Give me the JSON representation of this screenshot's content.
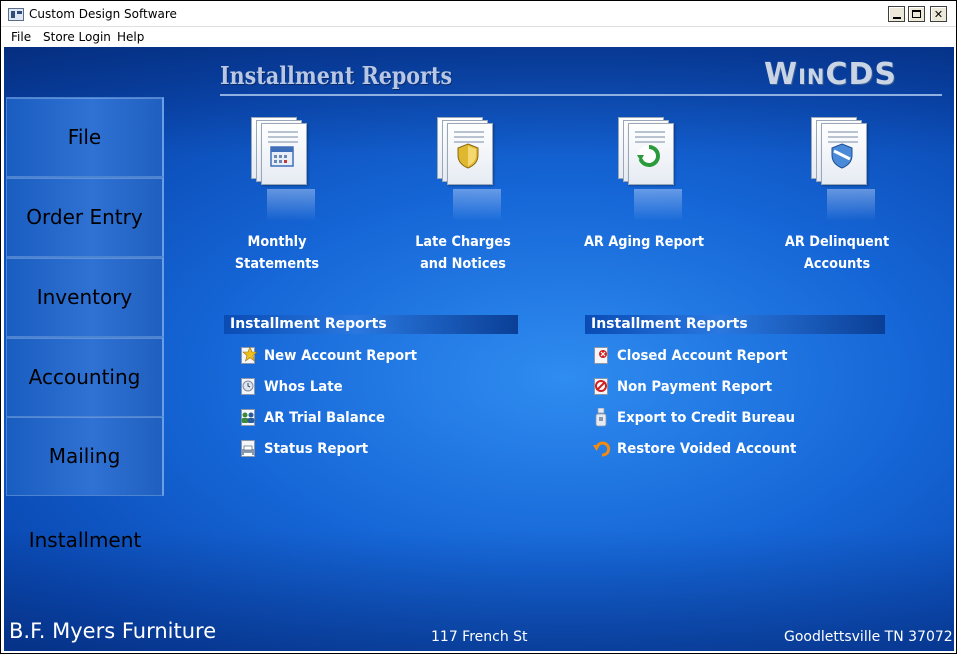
{
  "window": {
    "title": "Custom Design Software",
    "controls": {
      "minimize_icon": "minimize-icon",
      "maximize_icon": "maximize-icon",
      "close_label": "✕"
    }
  },
  "menubar": {
    "items": [
      "File",
      "Store Login",
      "Help"
    ]
  },
  "header": {
    "title": "Installment Reports",
    "brand": "WinCDS"
  },
  "nav": {
    "tabs": [
      "File",
      "Order Entry",
      "Inventory",
      "Accounting",
      "Mailing"
    ],
    "active": "Installment"
  },
  "reports": [
    {
      "label_line1": "Monthly Statements",
      "label_line2": "",
      "icon": "calendar-document-icon",
      "badge_color": "#3f6fb8"
    },
    {
      "label_line1": "Late Charges",
      "label_line2": "and Notices",
      "icon": "shield-document-icon",
      "badge_color": "#e0b830"
    },
    {
      "label_line1": "AR Aging Report",
      "label_line2": "",
      "icon": "refresh-document-icon",
      "badge_color": "#2a9a3a"
    },
    {
      "label_line1": "AR Delinquent",
      "label_line2": "Accounts",
      "icon": "shield-blue-document-icon",
      "badge_color": "#4a8ad8"
    }
  ],
  "sections": {
    "left": {
      "title": "Installment Reports",
      "items": [
        {
          "label": "New Account Report",
          "icon": "star-icon",
          "accent": "#f0c020"
        },
        {
          "label": "Whos Late",
          "icon": "clock-icon",
          "accent": "#7a8aa0"
        },
        {
          "label": "AR Trial Balance",
          "icon": "users-icon",
          "accent": "#3a8a3a"
        },
        {
          "label": "Status Report",
          "icon": "printer-icon",
          "accent": "#6a7a90"
        }
      ]
    },
    "right": {
      "title": "Installment Reports",
      "items": [
        {
          "label": "Closed Account Report",
          "icon": "close-doc-icon",
          "accent": "#d02020"
        },
        {
          "label": "Non Payment Report",
          "icon": "no-icon",
          "accent": "#d02020"
        },
        {
          "label": "Export to Credit Bureau",
          "icon": "export-icon",
          "accent": "#8a98ac"
        },
        {
          "label": "Restore Voided Account",
          "icon": "undo-icon",
          "accent": "#f08a10"
        }
      ]
    }
  },
  "footer": {
    "store_name": "B.F. Myers Furniture",
    "address": "117 French St",
    "city": "Goodlettsville TN 37072"
  }
}
